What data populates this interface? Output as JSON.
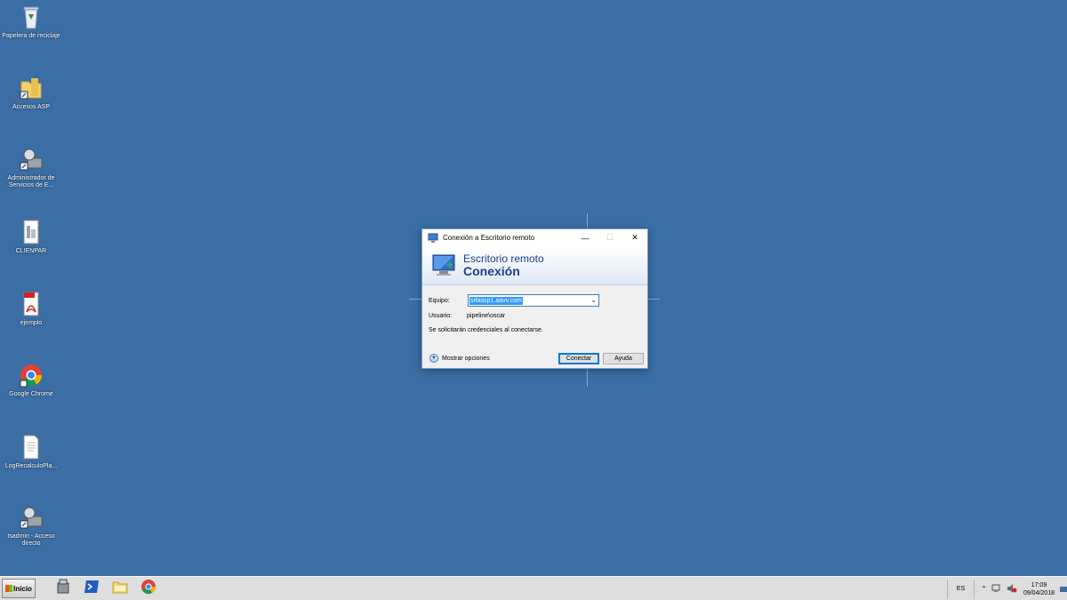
{
  "desktop": {
    "icons": [
      {
        "label": "Papelera de reciclaje",
        "icon": "recycle-bin-icon"
      },
      {
        "label": "Accesos ASP",
        "icon": "folder-shortcut-icon"
      },
      {
        "label": "Administrador de Servicios de E...",
        "icon": "server-admin-icon"
      },
      {
        "label": "CLIENPAR",
        "icon": "document-icon"
      },
      {
        "label": "ejemplo",
        "icon": "pdf-icon"
      },
      {
        "label": "Google Chrome",
        "icon": "chrome-icon"
      },
      {
        "label": "LogRecalculoPla...",
        "icon": "text-file-icon"
      },
      {
        "label": "tsadmin - Acceso directo",
        "icon": "server-admin-icon"
      }
    ]
  },
  "dialog": {
    "title": "Conexión a Escritorio remoto",
    "banner_line1": "Escritorio remoto",
    "banner_line2": "Conexión",
    "equipo_label": "Equipo:",
    "equipo_value": "srbiasp1.aavv.com",
    "usuario_label": "Usuario:",
    "usuario_value": "pipeline\\oscar",
    "note": "Se solicitarán credenciales al conectarse.",
    "options_label": "Mostrar opciones",
    "connect_label": "Conectar",
    "help_label": "Ayuda",
    "minimize": "—",
    "maximize": "☐",
    "close": "✕"
  },
  "taskbar": {
    "start_label": "Inicio",
    "apps": [
      "server-manager-icon",
      "powershell-icon",
      "file-explorer-icon",
      "chrome-icon"
    ],
    "language": "ES",
    "time": "17:09",
    "date": "09/04/2018"
  },
  "colors": {
    "desktop": "#3a6ea5",
    "accent": "#0078d7",
    "banner_text": "#1b3f8b"
  }
}
